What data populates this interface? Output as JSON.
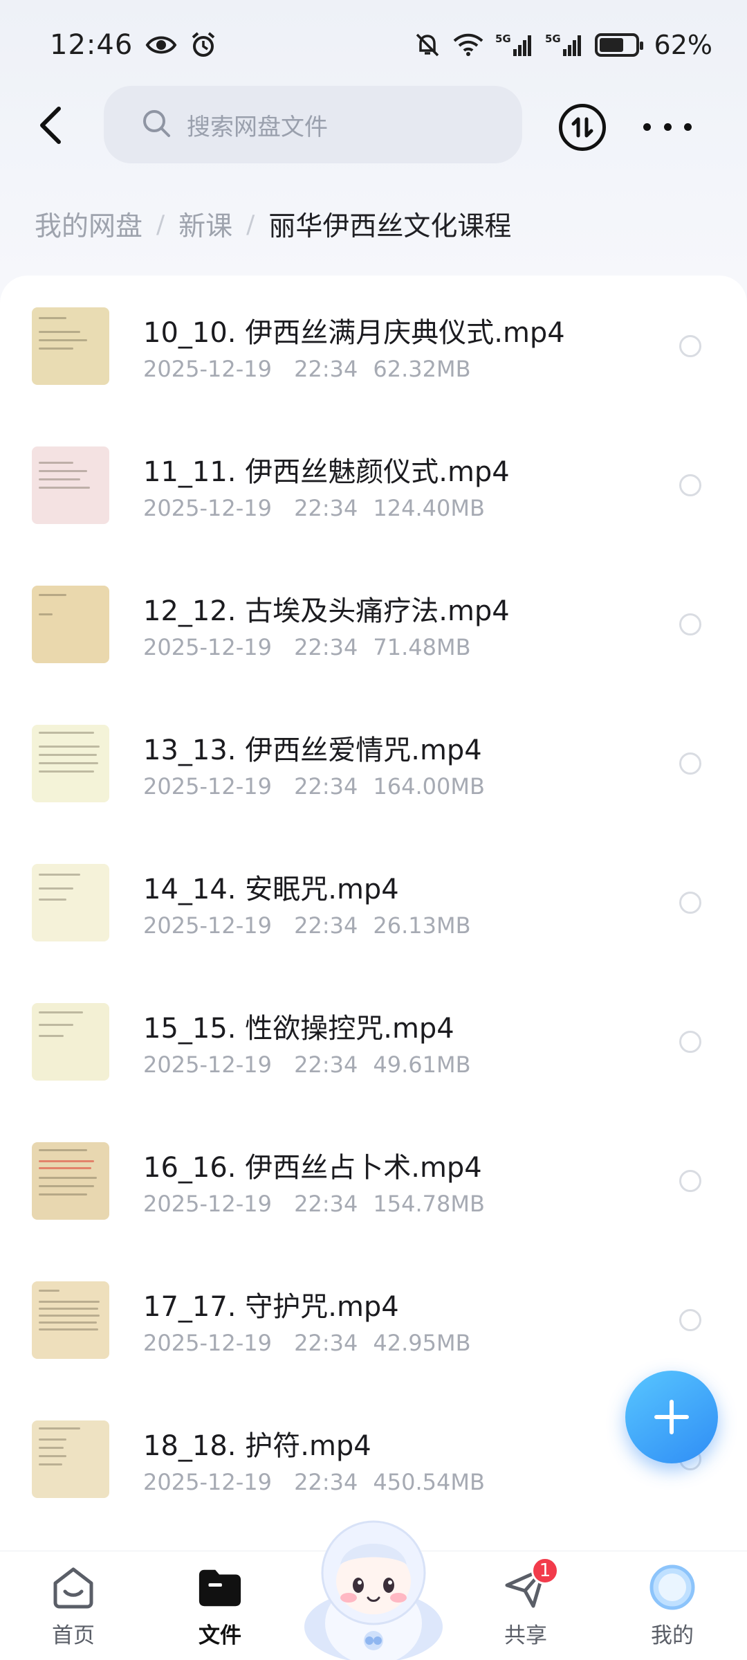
{
  "status_bar": {
    "time": "12:46",
    "battery": "62%",
    "icons": [
      "eye-icon",
      "alarm-icon",
      "bell-off-icon",
      "wifi-icon",
      "signal-5g-icon",
      "signal-5g-icon",
      "battery-icon"
    ]
  },
  "app_bar": {
    "search_placeholder": "搜索网盘文件"
  },
  "breadcrumb": {
    "items": [
      "我的网盘",
      "新课"
    ],
    "separator": "/",
    "current": "丽华伊西丝文化课程"
  },
  "files": [
    {
      "name": "10_10. 伊西丝满月庆典仪式.mp4",
      "date": "2025-12-19",
      "time": "22:34",
      "size": "62.32MB",
      "thumb_color": "#e9dcb3"
    },
    {
      "name": "11_11. 伊西丝魅颜仪式.mp4",
      "date": "2025-12-19",
      "time": "22:34",
      "size": "124.40MB",
      "thumb_color": "#f4e2e2"
    },
    {
      "name": "12_12. 古埃及头痛疗法.mp4",
      "date": "2025-12-19",
      "time": "22:34",
      "size": "71.48MB",
      "thumb_color": "#ead8ad"
    },
    {
      "name": "13_13. 伊西丝爱情咒.mp4",
      "date": "2025-12-19",
      "time": "22:34",
      "size": "164.00MB",
      "thumb_color": "#f4f3d8"
    },
    {
      "name": "14_14. 安眠咒.mp4",
      "date": "2025-12-19",
      "time": "22:34",
      "size": "26.13MB",
      "thumb_color": "#f5f2d9"
    },
    {
      "name": "15_15. 性欲操控咒.mp4",
      "date": "2025-12-19",
      "time": "22:34",
      "size": "49.61MB",
      "thumb_color": "#f3f0d4"
    },
    {
      "name": "16_16. 伊西丝占卜术.mp4",
      "date": "2025-12-19",
      "time": "22:34",
      "size": "154.78MB",
      "thumb_color": "#e8d7b0"
    },
    {
      "name": "17_17. 守护咒.mp4",
      "date": "2025-12-19",
      "time": "22:34",
      "size": "42.95MB",
      "thumb_color": "#eedfbc"
    },
    {
      "name": "18_18. 护符.mp4",
      "date": "2025-12-19",
      "time": "22:34",
      "size": "450.54MB",
      "thumb_color": "#eee2c2"
    }
  ],
  "bottom_nav": {
    "items": [
      {
        "label": "首页",
        "icon": "home-icon",
        "active": false
      },
      {
        "label": "文件",
        "icon": "folder-icon",
        "active": true
      },
      {
        "label": "",
        "icon": "mascot-icon",
        "active": false
      },
      {
        "label": "共享",
        "icon": "share-send-icon",
        "active": false,
        "badge": "1"
      },
      {
        "label": "我的",
        "icon": "profile-icon",
        "active": false
      }
    ]
  },
  "colors": {
    "accent": "#2f8df5",
    "badge": "#f23b4b",
    "meta_text": "#a6aab3"
  }
}
